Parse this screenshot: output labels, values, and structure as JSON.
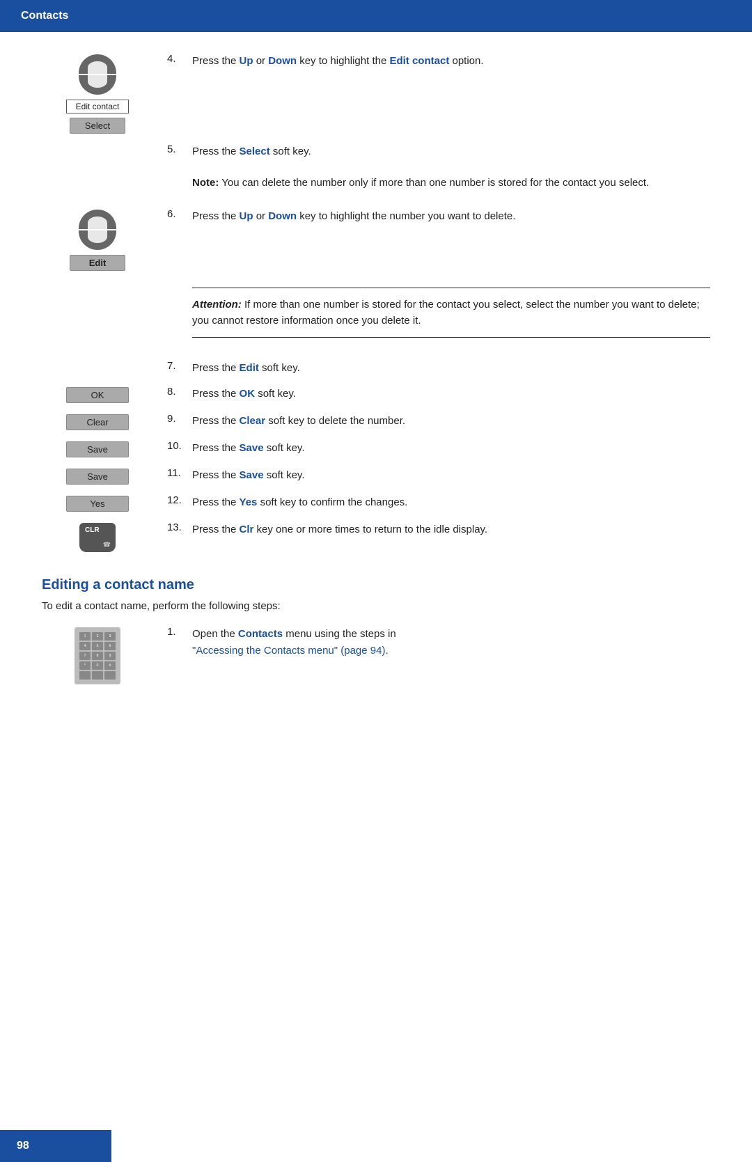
{
  "header": {
    "title": "Contacts"
  },
  "steps": [
    {
      "num": "4.",
      "icon": "nav-up-down",
      "text_parts": [
        "Press the ",
        "Up",
        " or ",
        "Down",
        " key to highlight the ",
        "Edit contact",
        " option."
      ]
    },
    {
      "num": "5.",
      "icon": "select-btn",
      "text_parts": [
        "Press the ",
        "Select",
        " soft key."
      ]
    },
    {
      "num": null,
      "icon": null,
      "note": "Note:",
      "note_text": " You can delete the number only if more than one number is stored for the contact you select."
    },
    {
      "num": "6.",
      "icon": "nav-up-down",
      "text_parts": [
        "Press the ",
        "Up",
        " or ",
        "Down",
        " key to highlight the number you want to delete."
      ]
    },
    {
      "num": null,
      "icon": null,
      "attention": true,
      "attention_label": "Attention:",
      "attention_text": " If more than one number is stored for the contact you select, select the number you want to delete; you cannot restore information once you delete it."
    },
    {
      "num": "7.",
      "icon": null,
      "text_parts": [
        "Press the ",
        "Edit",
        " soft key."
      ]
    },
    {
      "num": "8.",
      "icon": "ok-btn",
      "text_parts": [
        "Press the ",
        "OK",
        " soft key."
      ]
    },
    {
      "num": "9.",
      "icon": "clear-btn",
      "text_parts": [
        "Press the ",
        "Clear",
        " soft key to delete the number."
      ]
    },
    {
      "num": "10.",
      "icon": "save-btn",
      "text_parts": [
        "Press the ",
        "Save",
        " soft key."
      ]
    },
    {
      "num": "11.",
      "icon": "save-btn2",
      "text_parts": [
        "Press the ",
        "Save",
        " soft key."
      ]
    },
    {
      "num": "12.",
      "icon": "yes-btn",
      "text_parts": [
        "Press the ",
        "Yes",
        " soft key to confirm the changes."
      ]
    },
    {
      "num": "13.",
      "icon": "clr-key",
      "text_parts": [
        "Press the ",
        "Clr",
        " key one or more times to return to the idle display."
      ]
    }
  ],
  "section2": {
    "heading": "Editing a contact name",
    "intro": "To edit a contact name, perform the following steps:",
    "step1_num": "1.",
    "step1_text_parts": [
      "Open the ",
      "Contacts",
      " menu using the steps in "
    ],
    "step1_link": "\"Accessing the Contacts menu\" (page 94)."
  },
  "footer": {
    "page": "98"
  },
  "buttons": {
    "edit_contact": "Edit contact",
    "select": "Select",
    "edit": "Edit",
    "ok": "OK",
    "clear": "Clear",
    "save": "Save",
    "yes": "Yes"
  }
}
